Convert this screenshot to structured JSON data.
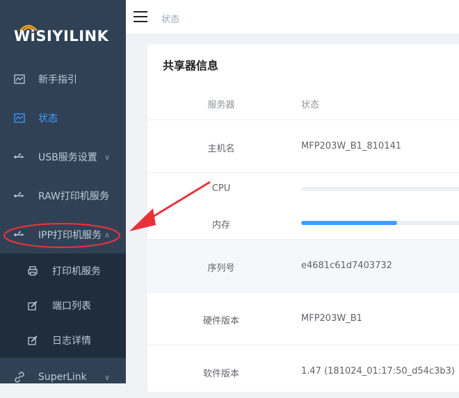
{
  "brand": {
    "logo_text": "WiSIYILINK",
    "accent": "#409eff",
    "annotation_color": "#e8323a"
  },
  "sidebar": {
    "items": [
      {
        "label": "新手指引",
        "icon": "chart-icon"
      },
      {
        "label": "状态",
        "icon": "chart-icon",
        "active": true
      },
      {
        "label": "USB服务设置",
        "icon": "usb-icon"
      },
      {
        "label": "RAW打印机服务",
        "icon": "usb-icon"
      },
      {
        "label": "IPP打印机服务",
        "icon": "usb-icon"
      },
      {
        "label": "SuperLink",
        "icon": "link-icon"
      }
    ],
    "submenu": [
      {
        "label": "打印机服务",
        "icon": "printer-icon"
      },
      {
        "label": "端口列表",
        "icon": "edit-icon"
      },
      {
        "label": "日志详情",
        "icon": "edit-icon"
      }
    ]
  },
  "header": {
    "breadcrumb": "状态"
  },
  "panel": {
    "title": "共享器信息",
    "columns": [
      "服务器",
      "状态"
    ],
    "rows": [
      {
        "label": "主机名",
        "value": "MFP203W_B1_810141"
      },
      {
        "label": "CPU",
        "progress": 0.0
      },
      {
        "label": "内存",
        "progress": 0.53
      },
      {
        "label": "序列号",
        "value": "e4681c61d7403732"
      },
      {
        "label": "硬件版本",
        "value": "MFP203W_B1"
      },
      {
        "label": "软件版本",
        "value": "1.47 (181024_01:17:50_d54c3b3)"
      }
    ]
  }
}
